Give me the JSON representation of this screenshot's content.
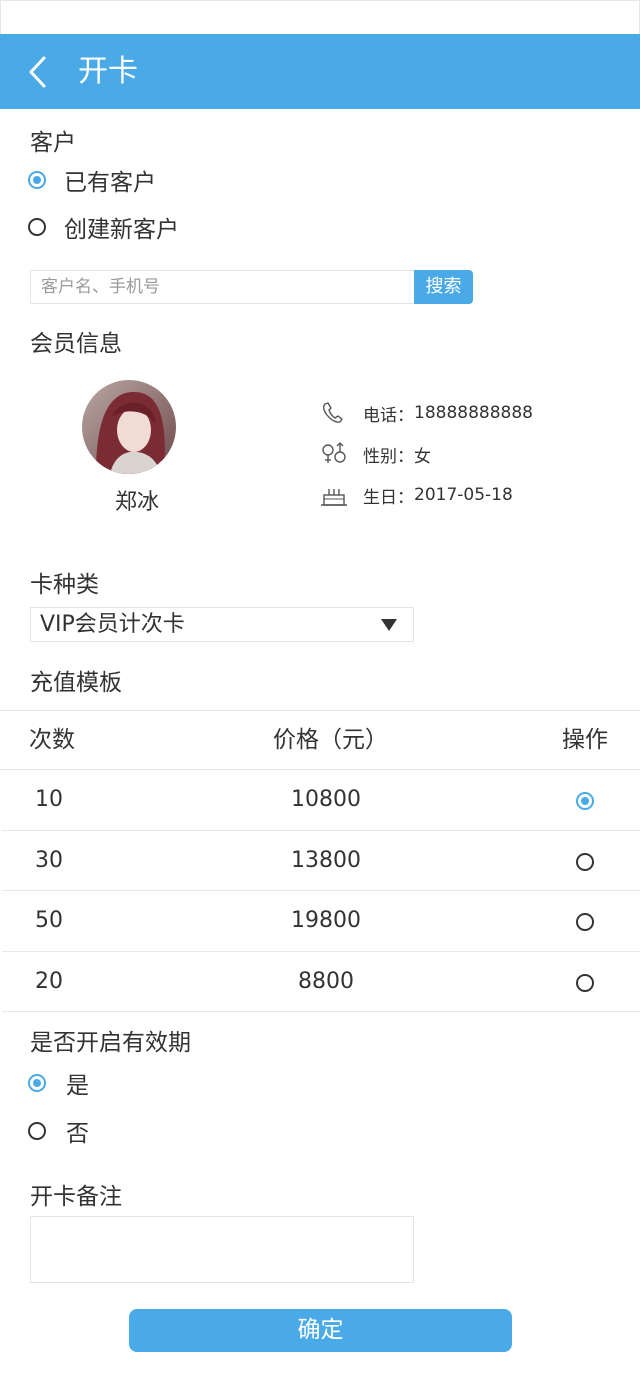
{
  "header": {
    "title": "开卡"
  },
  "customer": {
    "label": "客户",
    "options": [
      {
        "label": "已有客户",
        "selected": true
      },
      {
        "label": "创建新客户",
        "selected": false
      }
    ],
    "search_placeholder": "客户名、手机号",
    "search_value": "",
    "search_button": "搜索"
  },
  "member": {
    "label": "会员信息",
    "name": "郑冰",
    "phone_label": "电话：",
    "phone": "18888888888",
    "gender_label": "性别：",
    "gender": "女",
    "birthday_label": "生日：",
    "birthday": "2017-05-18"
  },
  "card_type": {
    "label": "卡种类",
    "value": "VIP会员计次卡"
  },
  "recharge": {
    "label": "充值模板",
    "columns": [
      "次数",
      "价格（元）",
      "操作"
    ],
    "rows": [
      {
        "count": "10",
        "price": "10800",
        "selected": true
      },
      {
        "count": "30",
        "price": "13800",
        "selected": false
      },
      {
        "count": "50",
        "price": "19800",
        "selected": false
      },
      {
        "count": "20",
        "price": "8800",
        "selected": false
      }
    ]
  },
  "validity": {
    "label": "是否开启有效期",
    "options": [
      {
        "label": "是",
        "selected": true
      },
      {
        "label": "否",
        "selected": false
      }
    ]
  },
  "remark": {
    "label": "开卡备注",
    "value": ""
  },
  "confirm_button": "确定",
  "colors": {
    "accent": "#4aaae8",
    "text": "#333333",
    "border": "#e3e3e3"
  },
  "icons": {
    "back": "chevron-left-icon",
    "phone": "phone-icon",
    "gender": "gender-icon",
    "birthday": "cake-icon"
  }
}
